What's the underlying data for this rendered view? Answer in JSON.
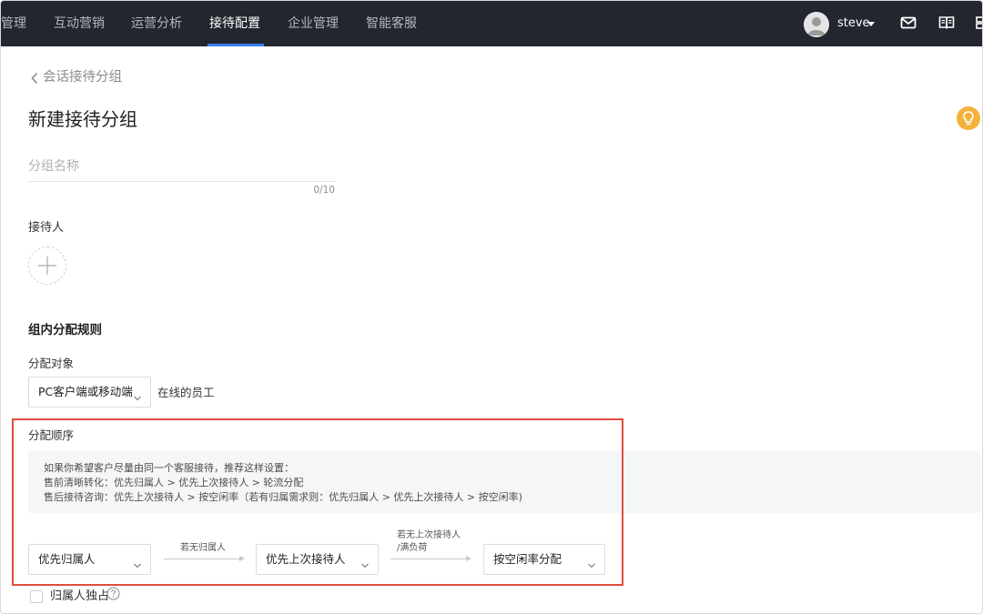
{
  "nav": {
    "items": [
      {
        "label": "管理",
        "active": false
      },
      {
        "label": "互动营销",
        "active": false
      },
      {
        "label": "运营分析",
        "active": false
      },
      {
        "label": "接待配置",
        "active": true
      },
      {
        "label": "企业管理",
        "active": false
      },
      {
        "label": "智能客服",
        "active": false
      }
    ],
    "user": "steve",
    "accent_color": "#3b7ff0",
    "icons": [
      "user-avatar-icon",
      "mail-icon",
      "book-icon",
      "grid-icon"
    ]
  },
  "breadcrumb": {
    "back_label": "会话接待分组"
  },
  "page": {
    "title": "新建接待分组"
  },
  "group_name": {
    "placeholder": "分组名称",
    "counter": "0/10"
  },
  "receptionist": {
    "label": "接待人"
  },
  "rules": {
    "title": "组内分配规则",
    "target_label": "分配对象",
    "target_select": "PC客户端或移动端",
    "target_suffix": "在线的员工",
    "order_label": "分配顺序",
    "tips": [
      "如果你希望客户尽量由同一个客服接待，推荐这样设置：",
      "售前清晰转化：优先归属人 > 优先上次接待人 > 轮流分配",
      "售后接待咨询：优先上次接待人 > 按空闲率（若有归属需求则：优先归属人 > 优先上次接待人 > 按空闲率)"
    ],
    "step1": "优先归属人",
    "arrow1_label": "若无归属人",
    "step2": "优先上次接待人",
    "arrow2_label_line1": "若无上次接待人",
    "arrow2_label_line2": "/满负荷",
    "step3": "按空闲率分配",
    "highlight_color": "#e24b3f"
  },
  "exclusive": {
    "label": "归属人独占"
  }
}
